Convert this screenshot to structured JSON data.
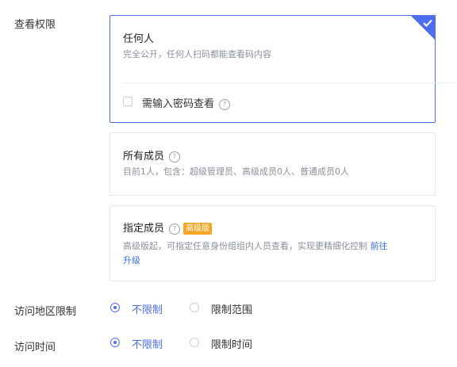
{
  "view_permission": {
    "label": "查看权限",
    "options": [
      {
        "title": "任何人",
        "desc": "完全公开，任何人扫码都能查看码内容",
        "password_checkbox_label": "需输入密码查看",
        "selected": true
      },
      {
        "title": "所有成员",
        "desc": "目前1人，包含：超级管理员、高级成员0人、普通成员0人"
      },
      {
        "title": "指定成员",
        "badge": "高级版",
        "desc": "高级版起，可指定任意身份组组内人员查看，实现更精细化控制",
        "link_part1": "前往",
        "link_part2": "升级"
      }
    ]
  },
  "region_limit": {
    "label": "访问地区限制",
    "options": [
      "不限制",
      "限制范围"
    ],
    "selected": "不限制"
  },
  "time_limit": {
    "label": "访问时间",
    "options": [
      "不限制",
      "限制时间"
    ],
    "selected": "不限制"
  },
  "colors": {
    "accent": "#4e6ef2",
    "badge": "#f5a623",
    "link": "#3a6df0"
  },
  "icons": {
    "help": "question-circle-icon",
    "check": "check-icon"
  }
}
